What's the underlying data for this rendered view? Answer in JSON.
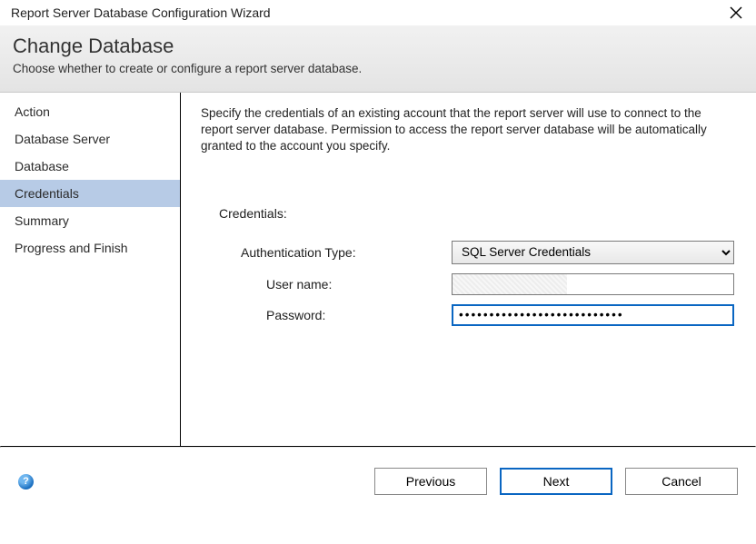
{
  "window": {
    "title": "Report Server Database Configuration Wizard"
  },
  "header": {
    "title": "Change Database",
    "subtitle": "Choose whether to create or configure a report server database."
  },
  "sidebar": {
    "items": [
      {
        "label": "Action"
      },
      {
        "label": "Database Server"
      },
      {
        "label": "Database"
      },
      {
        "label": "Credentials"
      },
      {
        "label": "Summary"
      },
      {
        "label": "Progress and Finish"
      }
    ],
    "active_index": 3
  },
  "main": {
    "instruction": "Specify the credentials of an existing account that the report server will use to connect to the report server database.  Permission to access the report server database will be automatically granted to the account you specify.",
    "section_label": "Credentials:",
    "auth_label": "Authentication Type:",
    "auth_value": "SQL Server Credentials",
    "user_label": "User name:",
    "user_value": "",
    "pwd_label": "Password:",
    "pwd_value": "•••••••••••••••••••••••••••"
  },
  "footer": {
    "help_glyph": "?",
    "previous": "Previous",
    "next": "Next",
    "cancel": "Cancel"
  }
}
